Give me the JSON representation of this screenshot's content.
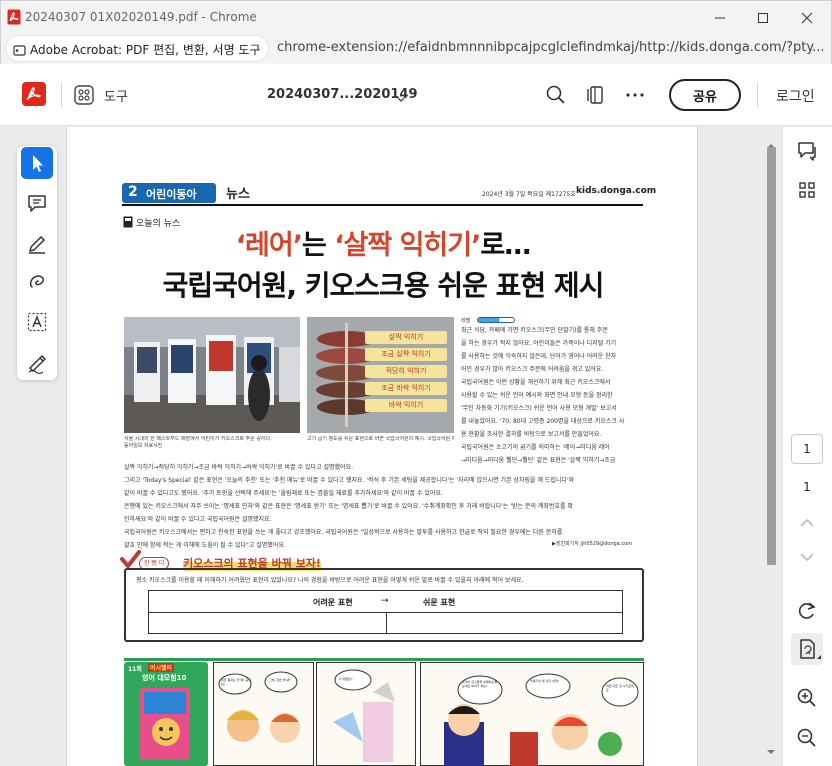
{
  "window": {
    "title": "20240307 01X02020149.pdf - Chrome"
  },
  "address": {
    "extension_name": "Adobe Acrobat: PDF 편집, 변환, 서명 도구",
    "url": "chrome-extension://efaidnbmnnnibpcajpcglclefindmkaj/http://kids.donga.com/?pty..."
  },
  "toolbar": {
    "tools_label": "도구",
    "file_name": "20240307...2020149",
    "share_label": "공유",
    "login_label": "로그인"
  },
  "colors": {
    "acrobat_red": "#e0261d",
    "tool_active": "#1473e6",
    "headline_red": "#d5452b",
    "section_blue": "#1967b3"
  },
  "left_tools": [
    "select-cursor-icon",
    "add-comment-icon",
    "highlight-pen-icon",
    "draw-freehand-icon",
    "text-select-icon",
    "fill-sign-icon"
  ],
  "right_panel": {
    "page_input": "1",
    "total_pages": "1"
  },
  "newspaper": {
    "section_num": "2",
    "section_name": "어린이동아",
    "section_tag": "뉴스",
    "date": "2024년 3월 7일 목요일 제17275호",
    "site": "kids.donga.com",
    "kicker": "오늘의 뉴스",
    "headline1_q1": "‘레어’",
    "headline1_mid1": "는 ",
    "headline1_q2": "‘살짝 익히기’",
    "headline1_mid2": "로…",
    "headline2": "국립국어원, 키오스크용 쉬운 표현 제시",
    "steak_labels": [
      "살짝 익히기",
      "조금 살짝 익히기",
      "적당히 익히기",
      "조금 바싹 익히기",
      "바싹 익히기"
    ],
    "photo_caption1": "서울 시내의 한 패스트푸드 매장에서 어린이가 키오스크로 주문 중이다.",
    "photo_caption1b": "동아일보 자료사진",
    "photo_caption2": "고기 굽기 정도를 쉬운 표현으로 바꾼 국립국어원의 예시. 국립국어원 제공",
    "reading_level": "레벨",
    "right_col": [
      "최근 식당, 카페에 가면 키오스크(무인 단말기)를 통해 주문",
      "을 하는 경우가 적지 않아요. 어린이들은 가족이나 디지털 기기",
      "를 사용하는 것에 익숙하지 않은데, 단어가 영어나 어려운 한자",
      "어인 경우가 많아 키오스크 주문에 어려움을 겪고 있어요.",
      "국립국어원은 이런 상황을 개선하기 위해 최근 키오스크에서",
      "사용할 수 있는 쉬운 언어 예시와 화면 안내 모형 등을 정리한",
      "'무인 자동화 기기(키오스크) 쉬운 언어 사용 모형 개발' 보고서",
      "를 내놓았어요. '70, 80대 고령층 200명을 대상으로 키오스크 사",
      "용 현황을 조사한 결과를 바탕으로 보고서를 만들었어요.",
      "국립국어원은 소고기의 굽기를 의미하는 '레어→미디움 레어",
      "→미디움→미디움 웰던→웰던' 같은 표현은 '살짝 익히기→조금"
    ],
    "full_col": [
      "살짝 익히기→적당히 익히기→조금 바싹 익히기→바싹 익히기'로 바꿀 수 있다고 설명했어요.",
      "그리고 'Today's Special' 같은 표현은 '오늘의 추천' 또는 '추천 메뉴'로 바꿀 수 있다고 했지요. '적석 후 기본 세팅을 제공합니다'는 '자리에 앉으시면 기본 상차림을 해 드립니다'와",
      "같이 바꿀 수 있다고도 했어요. '추가 토핑을 선택해 주세요'는 '올림재료 또는 겸들일 재료를 추가하세요'와 같이 바꿀 수 있어요.",
      "은행에 있는 키오스크에서 자주 쓰이는 '명세표 인자'와 같은 표현은 '명세표 받기' 또는 '명세표 뽑기'로 바꿀 수 있어요. '수취계좌확인 후 거래 바랍니다'는 '받는 분의 계좌번호를 확",
      "인하세요'와 같이 바꿀 수 있다고 국립국어원은 설명했지요.",
      "국립국어원은 키오스크에서는 편하고 친숙한 표현을 쓰는 게 좋다고 강조했어요. 국립국어원은 \"일상적으로 사용하는 말투를 사용하고 한글로 적되 필요한 경우에는 다른 문자를",
      "괄호 안에 함께 적는 게 이해에 도움이 될 수 있다\"고 설명했어요."
    ],
    "byline": "▶장진희기자 jjh0529@donga.com",
    "box_badge": "한 뼘 더",
    "box_title": "키오스크의 표현을 바꿔 보자!",
    "box_prompt": "평소 키오스크를 이용할 때 이해하기 어려웠던 표현이 있었나요? 나의 경험을 바탕으로 어려운 표현을 어떻게 쉬운 말로 바꿀 수 있을지 아래에 적어 보세요.",
    "table_col1": "어려운 표현",
    "table_arrow": "→",
    "table_col2": "쉬운 표현",
    "comic_num": "11회",
    "comic_title1": "머시멜의",
    "comic_title2": "영어 대모험10",
    "comic_bubbles": [
      "잠깐 통과는 안 돼! 공주님!",
      "그래, 한번 해 봐!",
      "이 애들은?",
      "주걱아 한구들을 실패하도록 보내는 봐야가 하는?",
      "그럼 무엇인가 해 봐!",
      "이야기의 빛 내가 하게!",
      "파란 다른 것 시키로워요",
      "잘 대답해 보자!"
    ]
  }
}
